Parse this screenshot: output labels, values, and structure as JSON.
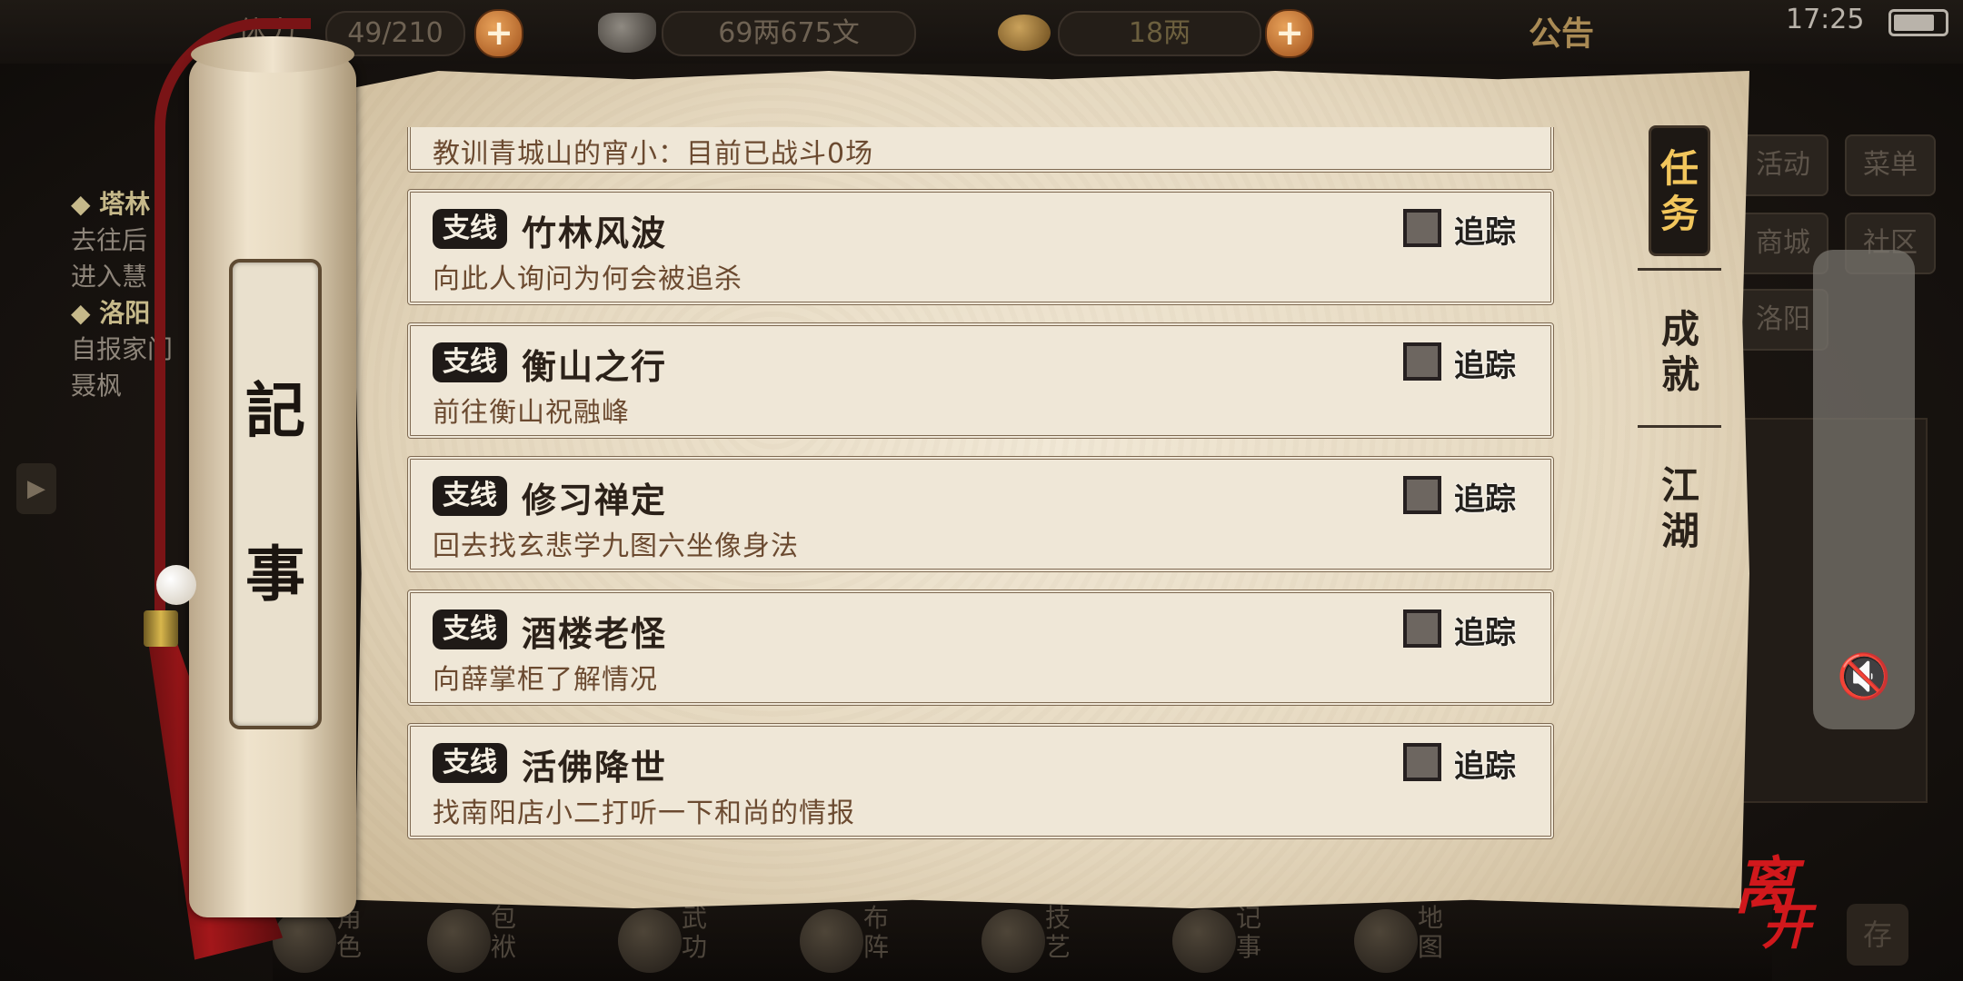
{
  "topbar": {
    "stamina_label": "体力",
    "stamina_value": "49/210",
    "money_value": "69两675文",
    "ingot_value": "18两",
    "notice": "公告",
    "time": "17:25"
  },
  "background_left": {
    "items": [
      {
        "head": "◆ 塔林",
        "lines": [
          "去往后",
          "进入慧"
        ]
      },
      {
        "head": "◆ 洛阳",
        "lines": [
          "自报家门",
          "聂枫"
        ]
      }
    ]
  },
  "background_right": {
    "buttons": [
      "活动",
      "菜单",
      "商城",
      "社区",
      "洛阳"
    ]
  },
  "scroll": {
    "rod_title_1": "記",
    "rod_title_2": "事"
  },
  "quests": {
    "partial_desc": "教训青城山的宵小：目前已战斗0场",
    "items": [
      {
        "tag": "支线",
        "title": "竹林风波",
        "desc": "向此人询问为何会被追杀",
        "track_label": "追踪"
      },
      {
        "tag": "支线",
        "title": "衡山之行",
        "desc": "前往衡山祝融峰",
        "track_label": "追踪"
      },
      {
        "tag": "支线",
        "title": "修习禅定",
        "desc": "回去找玄悲学九图六坐像身法",
        "track_label": "追踪"
      },
      {
        "tag": "支线",
        "title": "酒楼老怪",
        "desc": "向薛掌柜了解情况",
        "track_label": "追踪"
      },
      {
        "tag": "支线",
        "title": "活佛降世",
        "desc": "找南阳店小二打听一下和尚的情报",
        "track_label": "追踪"
      }
    ]
  },
  "tabs": {
    "task": [
      "任",
      "务"
    ],
    "achievement": [
      "成",
      "就"
    ],
    "jianghu": [
      "江",
      "湖"
    ]
  },
  "bottombar": {
    "items": [
      "角色",
      "包袱",
      "武功",
      "布阵",
      "技艺",
      "记事",
      "地图"
    ],
    "leave": [
      "离",
      "开"
    ],
    "store": "存"
  },
  "colors": {
    "tab_active_text": "#f2c65c",
    "tassel": "#a3171a",
    "leave_text": "#d1181c"
  }
}
